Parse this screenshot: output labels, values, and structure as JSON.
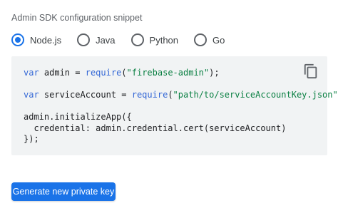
{
  "section": {
    "title": "Admin SDK configuration snippet"
  },
  "languages": {
    "selected": "Node.js",
    "options": [
      {
        "label": "Node.js"
      },
      {
        "label": "Java"
      },
      {
        "label": "Python"
      },
      {
        "label": "Go"
      }
    ]
  },
  "code": {
    "lines": [
      [
        "var",
        " admin = ",
        "require",
        "(",
        "\"firebase-admin\"",
        ");"
      ],
      [],
      [
        "var",
        " serviceAccount = ",
        "require",
        "(",
        "\"path/to/serviceAccountKey.json\"",
        ");"
      ],
      [],
      [
        "admin.initializeApp({"
      ],
      [
        "  credential: admin.credential.cert(serviceAccount)"
      ],
      [
        "});"
      ]
    ],
    "copy_icon": "content-copy-icon"
  },
  "actions": {
    "generate_key_label": "Generate new private key"
  },
  "colors": {
    "accent": "#1a73e8",
    "keyword": "#3367d6",
    "string": "#0b8043",
    "code_background": "#f1f3f4"
  }
}
